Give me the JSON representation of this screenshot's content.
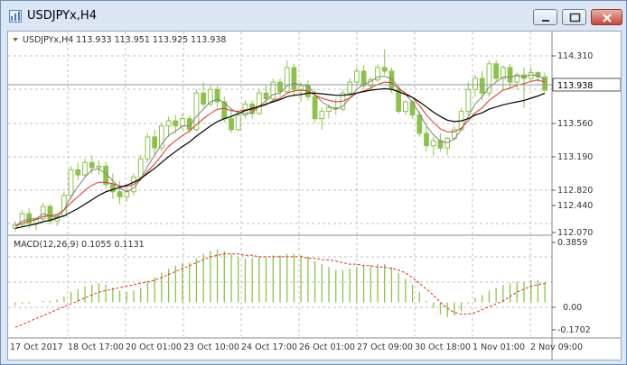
{
  "window": {
    "title": "USDJPYx,H4"
  },
  "chart_header": {
    "label": "USDJPYx,H4  113.933 113.951 113.925 113.938"
  },
  "price_axis": {
    "ticks": [
      "114.310",
      "113.938",
      "113.560",
      "113.190",
      "112.820",
      "112.440",
      "112.070"
    ],
    "current_price": "113.938"
  },
  "macd": {
    "label": "MACD(12,26,9) 0.1055 0.1131",
    "ticks": [
      "0.3859",
      "0.00",
      "-0.1702"
    ]
  },
  "time_axis": {
    "labels": [
      "17 Oct 2017",
      "18 Oct 17:00",
      "20 Oct 01:00",
      "23 Oct 10:00",
      "24 Oct 17:00",
      "26 Oct 01:00",
      "27 Oct 09:00",
      "30 Oct 18:00",
      "1 Nov 01:00",
      "2 Nov 09:00"
    ]
  },
  "colors": {
    "bull": "#8bc34a",
    "bear": "#8bc34a",
    "ma_fast": "#808080",
    "ma_mid": "#e0301e",
    "ma_slow": "#000000",
    "grid": "#c0c0c0",
    "axis_text": "#333333",
    "price_line": "#8a96a8"
  },
  "chart_data": {
    "type": "candlestick",
    "ylim": [
      111.98,
      114.52
    ],
    "macd_ylim": [
      -0.23,
      0.42
    ],
    "candles": [
      [
        112.05,
        112.15,
        112.0,
        112.1
      ],
      [
        112.1,
        112.3,
        112.08,
        112.25
      ],
      [
        112.25,
        112.32,
        112.05,
        112.12
      ],
      [
        112.12,
        112.2,
        112.02,
        112.18
      ],
      [
        112.18,
        112.4,
        112.15,
        112.35
      ],
      [
        112.35,
        112.38,
        112.1,
        112.15
      ],
      [
        112.15,
        112.25,
        112.08,
        112.22
      ],
      [
        112.22,
        112.55,
        112.2,
        112.5
      ],
      [
        112.5,
        112.9,
        112.45,
        112.85
      ],
      [
        112.85,
        112.95,
        112.7,
        112.78
      ],
      [
        112.78,
        113.0,
        112.75,
        112.95
      ],
      [
        112.95,
        113.05,
        112.8,
        112.88
      ],
      [
        112.88,
        112.98,
        112.78,
        112.9
      ],
      [
        112.9,
        112.96,
        112.6,
        112.65
      ],
      [
        112.65,
        112.8,
        112.45,
        112.55
      ],
      [
        112.55,
        112.7,
        112.38,
        112.48
      ],
      [
        112.48,
        112.6,
        112.42,
        112.55
      ],
      [
        112.55,
        112.8,
        112.5,
        112.75
      ],
      [
        112.75,
        113.05,
        112.7,
        113.0
      ],
      [
        113.0,
        113.35,
        112.95,
        113.3
      ],
      [
        113.3,
        113.4,
        113.05,
        113.15
      ],
      [
        113.15,
        113.5,
        113.1,
        113.45
      ],
      [
        113.45,
        113.58,
        113.3,
        113.52
      ],
      [
        113.52,
        113.6,
        113.35,
        113.45
      ],
      [
        113.45,
        113.62,
        113.4,
        113.55
      ],
      [
        113.55,
        113.6,
        113.35,
        113.4
      ],
      [
        113.4,
        113.95,
        113.38,
        113.9
      ],
      [
        113.9,
        114.05,
        113.7,
        113.75
      ],
      [
        113.75,
        114.0,
        113.72,
        113.95
      ],
      [
        113.95,
        114.0,
        113.7,
        113.78
      ],
      [
        113.78,
        113.85,
        113.5,
        113.55
      ],
      [
        113.55,
        113.7,
        113.35,
        113.4
      ],
      [
        113.4,
        113.65,
        113.38,
        113.6
      ],
      [
        113.6,
        113.8,
        113.55,
        113.75
      ],
      [
        113.75,
        113.8,
        113.55,
        113.62
      ],
      [
        113.62,
        113.95,
        113.6,
        113.9
      ],
      [
        113.9,
        114.0,
        113.75,
        113.82
      ],
      [
        113.82,
        114.1,
        113.8,
        114.05
      ],
      [
        114.05,
        114.1,
        113.85,
        113.92
      ],
      [
        113.92,
        114.35,
        113.9,
        114.25
      ],
      [
        114.25,
        114.3,
        113.85,
        113.95
      ],
      [
        113.95,
        114.05,
        113.78,
        114.0
      ],
      [
        114.0,
        114.08,
        113.8,
        113.85
      ],
      [
        113.85,
        113.95,
        113.5,
        113.55
      ],
      [
        113.55,
        113.7,
        113.4,
        113.65
      ],
      [
        113.65,
        113.75,
        113.55,
        113.7
      ],
      [
        113.7,
        113.82,
        113.6,
        113.68
      ],
      [
        113.68,
        113.95,
        113.65,
        113.9
      ],
      [
        113.9,
        114.1,
        113.85,
        114.05
      ],
      [
        114.05,
        114.25,
        114.0,
        114.2
      ],
      [
        114.2,
        114.28,
        113.95,
        114.0
      ],
      [
        114.0,
        114.12,
        113.95,
        114.08
      ],
      [
        114.08,
        114.3,
        114.05,
        114.25
      ],
      [
        114.25,
        114.5,
        114.15,
        114.2
      ],
      [
        114.2,
        114.25,
        113.9,
        113.95
      ],
      [
        113.95,
        114.0,
        113.62,
        113.65
      ],
      [
        113.65,
        113.8,
        113.6,
        113.78
      ],
      [
        113.78,
        113.8,
        113.55,
        113.6
      ],
      [
        113.6,
        113.65,
        113.3,
        113.35
      ],
      [
        113.35,
        113.45,
        113.1,
        113.18
      ],
      [
        113.18,
        113.3,
        113.05,
        113.25
      ],
      [
        113.25,
        113.35,
        113.1,
        113.15
      ],
      [
        113.15,
        113.3,
        113.05,
        113.28
      ],
      [
        113.28,
        113.45,
        113.25,
        113.4
      ],
      [
        113.4,
        113.7,
        113.38,
        113.65
      ],
      [
        113.65,
        114.05,
        113.6,
        113.95
      ],
      [
        113.95,
        114.15,
        113.85,
        114.1
      ],
      [
        114.1,
        114.2,
        113.8,
        113.9
      ],
      [
        113.9,
        114.35,
        113.85,
        114.3
      ],
      [
        114.3,
        114.35,
        114.05,
        114.1
      ],
      [
        114.1,
        114.28,
        113.95,
        114.25
      ],
      [
        114.25,
        114.3,
        113.95,
        114.05
      ],
      [
        114.05,
        114.18,
        113.95,
        114.15
      ],
      [
        114.15,
        114.25,
        113.7,
        114.1
      ],
      [
        114.1,
        114.25,
        114.05,
        114.18
      ],
      [
        114.18,
        114.2,
        114.05,
        114.12
      ],
      [
        114.12,
        114.18,
        113.92,
        113.94
      ]
    ],
    "ma_slow": [
      112.05,
      112.07,
      112.09,
      112.11,
      112.14,
      112.16,
      112.19,
      112.22,
      112.27,
      112.32,
      112.38,
      112.44,
      112.5,
      112.55,
      112.58,
      112.61,
      112.64,
      112.68,
      112.73,
      112.8,
      112.87,
      112.95,
      113.03,
      113.1,
      113.17,
      113.23,
      113.31,
      113.38,
      113.45,
      113.51,
      113.55,
      113.58,
      113.62,
      113.66,
      113.69,
      113.72,
      113.75,
      113.78,
      113.81,
      113.85,
      113.87,
      113.88,
      113.9,
      113.9,
      113.89,
      113.88,
      113.87,
      113.87,
      113.88,
      113.9,
      113.92,
      113.94,
      113.95,
      113.96,
      113.95,
      113.92,
      113.88,
      113.84,
      113.78,
      113.71,
      113.64,
      113.58,
      113.53,
      113.51,
      113.52,
      113.55,
      113.6,
      113.63,
      113.68,
      113.71,
      113.74,
      113.76,
      113.78,
      113.8,
      113.83,
      113.86,
      113.9
    ],
    "ma_mid": [
      112.08,
      112.12,
      112.15,
      112.17,
      112.21,
      112.22,
      112.24,
      112.3,
      112.4,
      112.48,
      112.57,
      112.64,
      112.68,
      112.68,
      112.66,
      112.63,
      112.62,
      112.65,
      112.72,
      112.83,
      112.93,
      113.05,
      113.17,
      113.25,
      113.32,
      113.38,
      113.47,
      113.55,
      113.62,
      113.68,
      113.69,
      113.66,
      113.65,
      113.67,
      113.67,
      113.71,
      113.74,
      113.8,
      113.83,
      113.9,
      113.93,
      113.94,
      113.93,
      113.87,
      113.83,
      113.8,
      113.78,
      113.79,
      113.83,
      113.9,
      113.93,
      113.97,
      114.02,
      114.05,
      114.04,
      113.96,
      113.9,
      113.84,
      113.73,
      113.6,
      113.5,
      113.41,
      113.37,
      113.37,
      113.42,
      113.52,
      113.63,
      113.7,
      113.8,
      113.87,
      113.94,
      113.97,
      114.01,
      114.03,
      114.06,
      114.08,
      114.05
    ],
    "ma_fast": [
      112.08,
      112.15,
      112.18,
      112.18,
      112.25,
      112.22,
      112.2,
      112.3,
      112.48,
      112.62,
      112.75,
      112.85,
      112.86,
      112.8,
      112.7,
      112.6,
      112.55,
      112.6,
      112.72,
      112.9,
      113.05,
      113.2,
      113.32,
      113.38,
      113.45,
      113.45,
      113.58,
      113.68,
      113.78,
      113.82,
      113.77,
      113.68,
      113.63,
      113.62,
      113.63,
      113.72,
      113.8,
      113.88,
      113.9,
      114.0,
      114.03,
      114.02,
      114.0,
      113.88,
      113.78,
      113.72,
      113.68,
      113.72,
      113.83,
      113.95,
      114.02,
      114.06,
      114.12,
      114.13,
      114.1,
      113.98,
      113.88,
      113.78,
      113.62,
      113.45,
      113.33,
      113.24,
      113.22,
      113.27,
      113.4,
      113.58,
      113.75,
      113.85,
      113.98,
      114.05,
      114.12,
      114.12,
      114.14,
      114.12,
      114.15,
      114.14,
      114.08
    ],
    "macd_hist": [
      -0.02,
      -0.01,
      -0.01,
      0.0,
      0.01,
      0.01,
      0.02,
      0.04,
      0.07,
      0.09,
      0.11,
      0.12,
      0.13,
      0.12,
      0.1,
      0.08,
      0.07,
      0.08,
      0.1,
      0.14,
      0.17,
      0.2,
      0.23,
      0.25,
      0.27,
      0.27,
      0.3,
      0.33,
      0.35,
      0.36,
      0.35,
      0.33,
      0.31,
      0.3,
      0.3,
      0.31,
      0.31,
      0.32,
      0.32,
      0.33,
      0.33,
      0.32,
      0.31,
      0.28,
      0.26,
      0.24,
      0.22,
      0.22,
      0.23,
      0.24,
      0.25,
      0.25,
      0.26,
      0.26,
      0.24,
      0.2,
      0.16,
      0.12,
      0.07,
      0.01,
      -0.04,
      -0.08,
      -0.1,
      -0.09,
      -0.06,
      -0.01,
      0.03,
      0.05,
      0.08,
      0.1,
      0.12,
      0.13,
      0.14,
      0.14,
      0.15,
      0.15,
      0.14
    ],
    "macd_signal": [
      -0.17,
      -0.15,
      -0.13,
      -0.11,
      -0.09,
      -0.07,
      -0.05,
      -0.03,
      -0.01,
      0.01,
      0.03,
      0.05,
      0.07,
      0.08,
      0.09,
      0.1,
      0.11,
      0.12,
      0.13,
      0.14,
      0.15,
      0.17,
      0.19,
      0.21,
      0.23,
      0.25,
      0.27,
      0.29,
      0.31,
      0.32,
      0.33,
      0.33,
      0.33,
      0.32,
      0.32,
      0.31,
      0.31,
      0.31,
      0.31,
      0.31,
      0.31,
      0.31,
      0.3,
      0.3,
      0.29,
      0.29,
      0.28,
      0.27,
      0.26,
      0.26,
      0.25,
      0.25,
      0.24,
      0.24,
      0.23,
      0.22,
      0.2,
      0.17,
      0.13,
      0.09,
      0.05,
      0.0,
      -0.04,
      -0.07,
      -0.08,
      -0.08,
      -0.07,
      -0.05,
      -0.03,
      -0.01,
      0.01,
      0.04,
      0.07,
      0.09,
      0.11,
      0.12,
      0.13
    ]
  }
}
